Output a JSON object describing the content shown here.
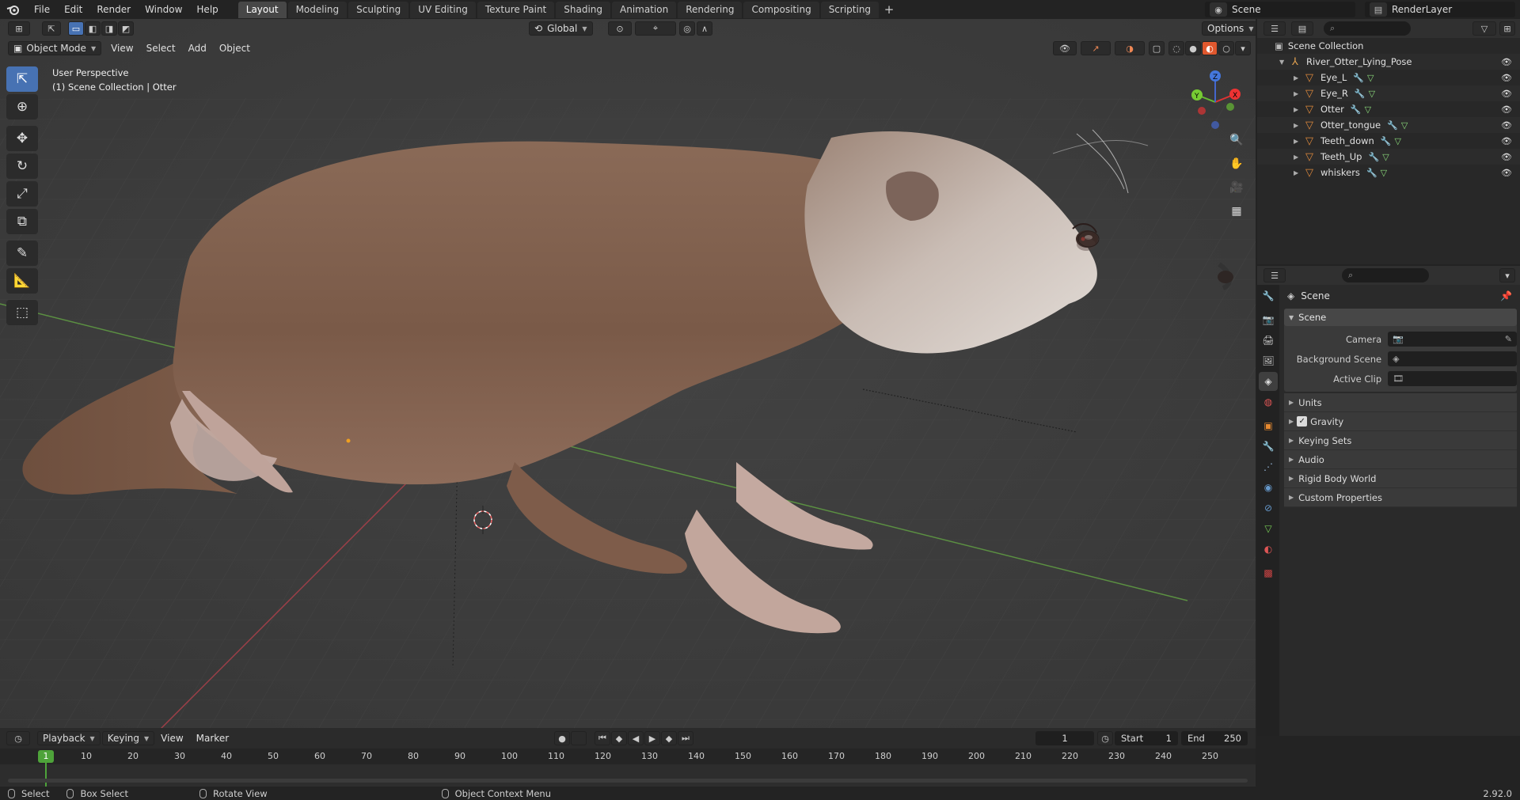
{
  "menu": [
    "File",
    "Edit",
    "Render",
    "Window",
    "Help"
  ],
  "workspaces": {
    "active": "Layout",
    "tabs": [
      "Layout",
      "Modeling",
      "Sculpting",
      "UV Editing",
      "Texture Paint",
      "Shading",
      "Animation",
      "Rendering",
      "Compositing",
      "Scripting"
    ]
  },
  "top_right": {
    "scene": "Scene",
    "view_layer": "RenderLayer"
  },
  "viewport": {
    "mode": "Object Mode",
    "menus": [
      "View",
      "Select",
      "Add",
      "Object"
    ],
    "orientation": "Global",
    "options": "Options",
    "overlay_line1": "User Perspective",
    "overlay_line2": "(1) Scene Collection | Otter",
    "gizmo_axes": [
      "X",
      "Y",
      "Z"
    ]
  },
  "outliner": {
    "root": "Scene Collection",
    "collection": "River_Otter_Lying_Pose",
    "objects": [
      "Eye_L",
      "Eye_R",
      "Otter",
      "Otter_tongue",
      "Teeth_down",
      "Teeth_Up",
      "whiskers"
    ]
  },
  "properties": {
    "context": "Scene",
    "panel": "Scene",
    "fields": [
      {
        "label": "Camera"
      },
      {
        "label": "Background Scene"
      },
      {
        "label": "Active Clip"
      }
    ],
    "collapsed_panels": [
      "Units",
      "Gravity",
      "Keying Sets",
      "Audio",
      "Rigid Body World",
      "Custom Properties"
    ],
    "gravity_checked": true
  },
  "timeline": {
    "menus": [
      "Playback",
      "Keying",
      "View",
      "Marker"
    ],
    "current_frame": "1",
    "start_label": "Start",
    "start": "1",
    "end_label": "End",
    "end": "250",
    "ticks": [
      "10",
      "20",
      "30",
      "40",
      "50",
      "60",
      "70",
      "80",
      "90",
      "100",
      "110",
      "120",
      "130",
      "140",
      "150",
      "160",
      "170",
      "180",
      "190",
      "200",
      "210",
      "220",
      "230",
      "240",
      "250"
    ],
    "playhead": "1"
  },
  "status": {
    "select": "Select",
    "box_select": "Box Select",
    "rotate": "Rotate View",
    "context_menu": "Object Context Menu",
    "version": "2.92.0"
  },
  "colors": {
    "accent": "#4772b3",
    "object_icon": "#e08a3c",
    "playhead": "#4ea33a"
  }
}
